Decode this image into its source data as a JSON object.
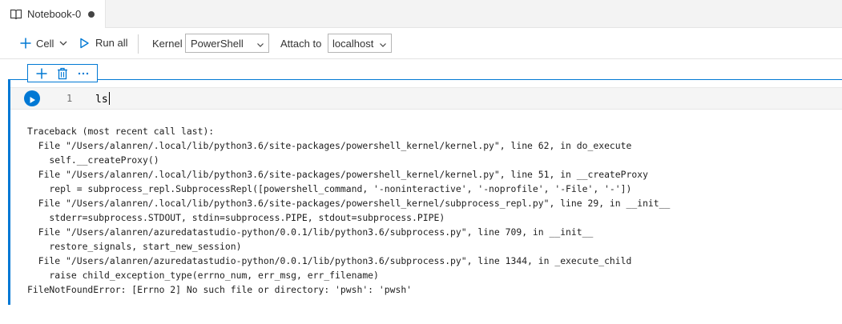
{
  "tab": {
    "title": "Notebook-0",
    "icon": "book-icon",
    "dirty": true
  },
  "toolbar": {
    "cell_label": "Cell",
    "run_all_label": "Run all",
    "kernel_label": "Kernel",
    "kernel_value": "PowerShell",
    "attach_label": "Attach to",
    "attach_value": "localhost"
  },
  "cell": {
    "toolbar_icons": [
      "add-icon",
      "trash-icon",
      "more-icon"
    ],
    "line_number": "1",
    "code": "ls",
    "output_lines": [
      "Traceback (most recent call last):",
      "  File \"/Users/alanren/.local/lib/python3.6/site-packages/powershell_kernel/kernel.py\", line 62, in do_execute",
      "    self.__createProxy()",
      "  File \"/Users/alanren/.local/lib/python3.6/site-packages/powershell_kernel/kernel.py\", line 51, in __createProxy",
      "    repl = subprocess_repl.SubprocessRepl([powershell_command, '-noninteractive', '-noprofile', '-File', '-'])",
      "  File \"/Users/alanren/.local/lib/python3.6/site-packages/powershell_kernel/subprocess_repl.py\", line 29, in __init__",
      "    stderr=subprocess.STDOUT, stdin=subprocess.PIPE, stdout=subprocess.PIPE)",
      "  File \"/Users/alanren/azuredatastudio-python/0.0.1/lib/python3.6/subprocess.py\", line 709, in __init__",
      "    restore_signals, start_new_session)",
      "  File \"/Users/alanren/azuredatastudio-python/0.0.1/lib/python3.6/subprocess.py\", line 1344, in _execute_child",
      "    raise child_exception_type(errno_num, err_msg, err_filename)",
      "FileNotFoundError: [Errno 2] No such file or directory: 'pwsh': 'pwsh'"
    ]
  },
  "colors": {
    "accent": "#0078d4",
    "code_bg": "#f5f5f5"
  }
}
